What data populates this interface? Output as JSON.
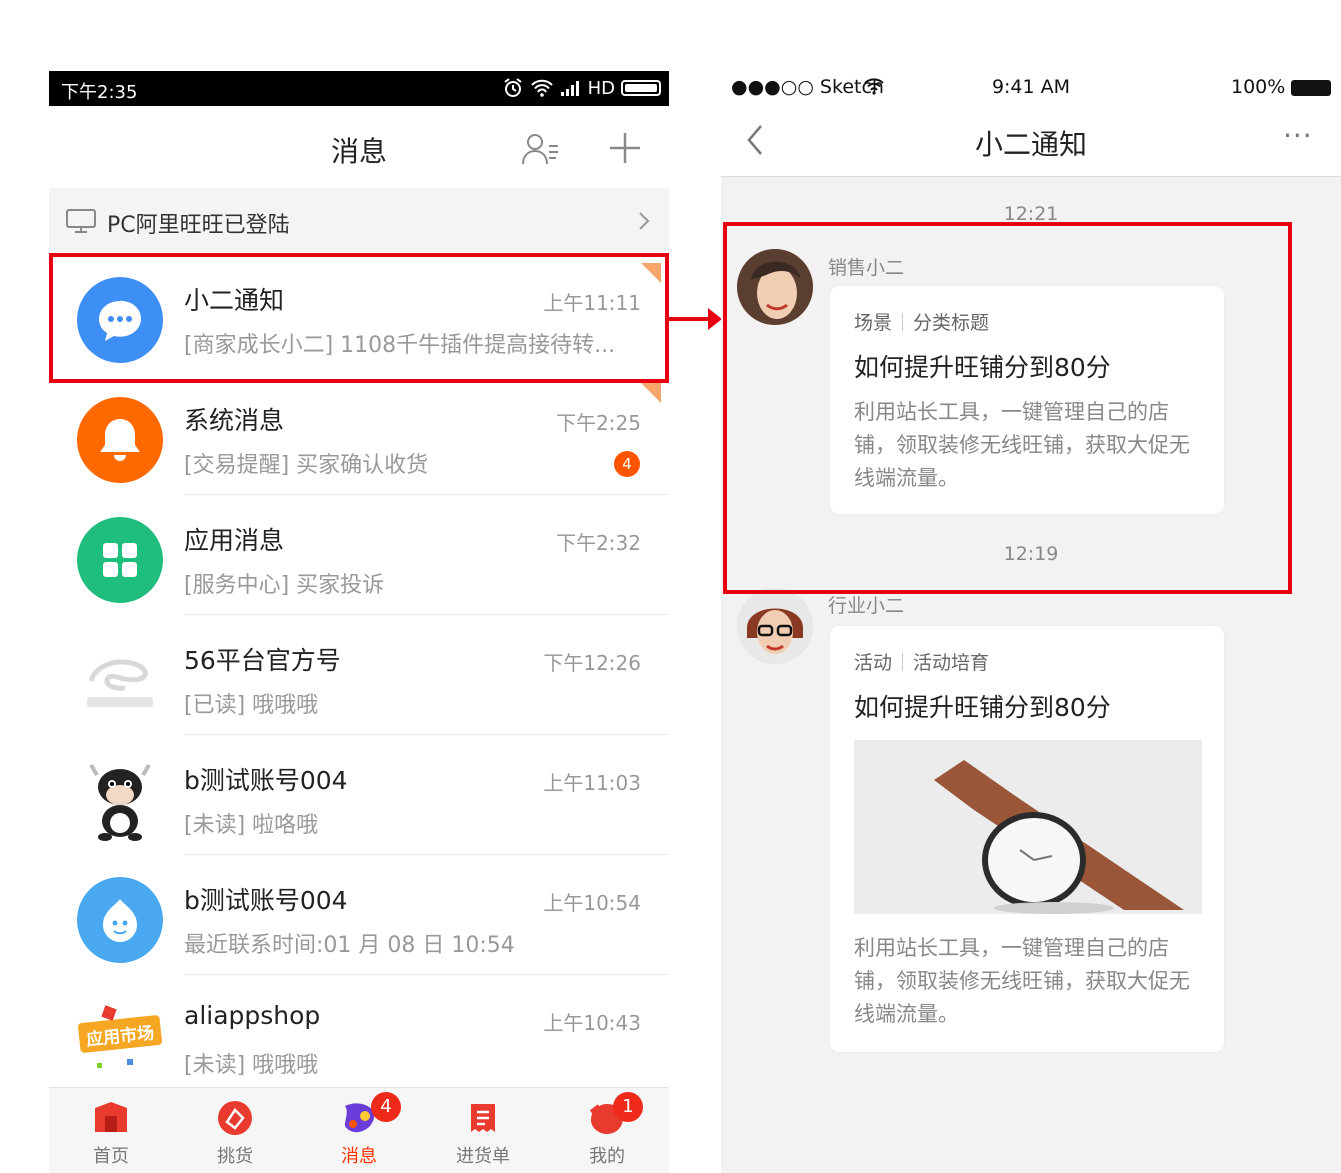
{
  "left": {
    "status": {
      "time": "下午2:35",
      "network": "HD"
    },
    "nav": {
      "title": "消息"
    },
    "pc_bar": {
      "label": "PC阿里旺旺已登陆"
    },
    "items": [
      {
        "name": "小二通知",
        "time": "上午11:11",
        "preview": "[商家成长小二] 1108千牛插件提高接待转...",
        "icon": "chat-bubble-icon",
        "color": "#3d8ef5"
      },
      {
        "name": "系统消息",
        "time": "下午2:25",
        "preview": "[交易提醒] 买家确认收货",
        "badge": "4",
        "icon": "bell-icon",
        "color": "#ff6a00"
      },
      {
        "name": "应用消息",
        "time": "下午2:32",
        "preview": "[服务中心] 买家投诉",
        "icon": "grid-icon",
        "color": "#1fbd7e"
      },
      {
        "name": "56平台官方号",
        "time": "下午12:26",
        "preview": "[已读] 哦哦哦",
        "icon": "alibaba-logo-icon"
      },
      {
        "name": "b测试账号004",
        "time": "上午11:03",
        "preview": "[未读] 啦咯哦",
        "icon": "cow-avatar-icon"
      },
      {
        "name": "b测试账号004",
        "time": "上午10:54",
        "preview": "最近联系时间:01 月 08 日  10:54",
        "icon": "wangwang-icon",
        "color": "#4aa8f0"
      },
      {
        "name": "aliappshop",
        "time": "上午10:43",
        "preview": "[未读] 哦哦哦",
        "icon": "app-market-icon",
        "avatar_text": "应用市场"
      }
    ],
    "tabs": [
      {
        "label": "首页",
        "icon": "home-icon"
      },
      {
        "label": "挑货",
        "icon": "shopping-icon"
      },
      {
        "label": "消息",
        "icon": "message-icon",
        "badge": "4",
        "active": true
      },
      {
        "label": "进货单",
        "icon": "cart-list-icon"
      },
      {
        "label": "我的",
        "icon": "profile-icon",
        "badge": "1"
      }
    ]
  },
  "right": {
    "status": {
      "carrier": "●●●○○ Sketch",
      "time": "9:41 AM",
      "battery": "100%"
    },
    "nav": {
      "title": "小二通知",
      "more": "···"
    },
    "messages": [
      {
        "timestamp": "12:21",
        "sender": "销售小二",
        "tag1": "场景",
        "tag2": "分类标题",
        "title": "如何提升旺铺分到80分",
        "body": "利用站长工具，一键管理自己的店铺，领取装修无线旺铺，获取大促无线端流量。"
      },
      {
        "timestamp": "12:19",
        "sender": "行业小二",
        "tag1": "活动",
        "tag2": "活动培育",
        "title": "如何提升旺铺分到80分",
        "body": "利用站长工具，一键管理自己的店铺，领取装修无线旺铺，获取大促无线端流量。"
      }
    ]
  },
  "colors": {
    "accent": "#e60012",
    "active_tab": "#ff3300",
    "badge": "#ff5500"
  }
}
